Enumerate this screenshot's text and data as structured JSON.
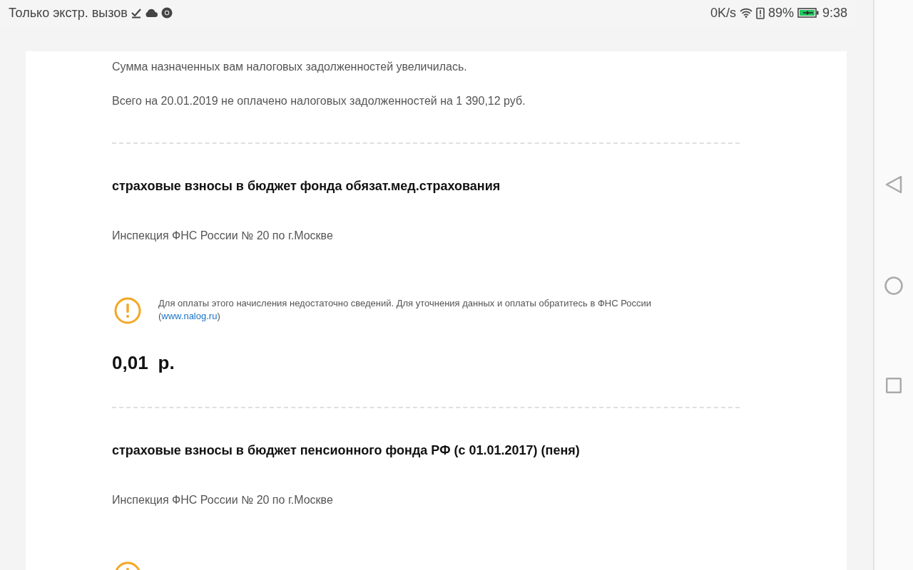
{
  "status_bar": {
    "carrier": "Только экстр. вызов",
    "speed": "0K/s",
    "battery": "89%",
    "time": "9:38"
  },
  "intro": [
    "Сумма назначенных вам налоговых задолженностей увеличилась.",
    "Всего на 20.01.2019 не оплачено налоговых задолженностей на 1 390,12 руб."
  ],
  "charges": [
    {
      "title": "страховые взносы в бюджет фонда обязат.мед.страхования",
      "inspection": "Инспекция ФНС России № 20 по г.Москве",
      "warning": {
        "kind": "full",
        "text": "Для оплаты этого начисления недостаточно сведений. Для уточнения данных и оплаты обратитесь в ФНС России (",
        "link": "www.nalog.ru",
        "after": ")"
      },
      "amount": "0,01",
      "currency": "р."
    },
    {
      "title": "страховые взносы в бюджет пенсионного фонда РФ (с 01.01.2017) (пеня)",
      "inspection": "Инспекция ФНС России № 20 по г.Москве",
      "warning": {
        "kind": "partial"
      }
    }
  ]
}
